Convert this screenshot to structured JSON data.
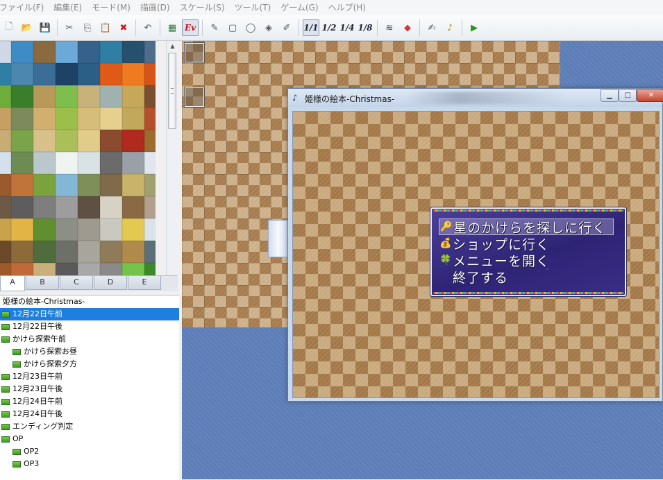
{
  "menubar": {
    "items": [
      {
        "key": "file",
        "label": "ファイル(F)"
      },
      {
        "key": "edit",
        "label": "編集(E)"
      },
      {
        "key": "mode",
        "label": "モード(M)"
      },
      {
        "key": "draw",
        "label": "描画(D)"
      },
      {
        "key": "scale",
        "label": "スケール(S)"
      },
      {
        "key": "tools",
        "label": "ツール(T)"
      },
      {
        "key": "game",
        "label": "ゲーム(G)"
      },
      {
        "key": "help",
        "label": "ヘルプ(H)"
      }
    ]
  },
  "toolbar": {
    "icons": [
      "new-project-icon",
      "open-project-icon",
      "save-project-icon",
      "cut-icon",
      "copy-icon",
      "paste-icon",
      "delete-icon",
      "undo-icon",
      "map-layer-icon",
      "event-layer-icon",
      "pencil-icon",
      "rectangle-icon",
      "ellipse-icon",
      "fill-icon",
      "shadow-pen-icon",
      "database-icon",
      "material-manager-icon",
      "script-editor-icon",
      "sound-test-icon",
      "playtest-icon"
    ],
    "ev_label": "Ev",
    "scales": [
      "1/1",
      "1/2",
      "1/4",
      "1/8"
    ]
  },
  "tileset": {
    "tabs": [
      "A",
      "B",
      "C",
      "D",
      "E"
    ],
    "active_tab": "A",
    "colors": [
      "#cfd8e6",
      "#3f8cc4",
      "#8a6a3e",
      "#6aa9d8",
      "#36618a",
      "#2f7fa5",
      "#274f6e",
      "#4d6d8a",
      "#2f7fa5",
      "#4c87b0",
      "#3b6d98",
      "#1e4266",
      "#2c5f85",
      "#e05a17",
      "#f07a1f",
      "#d4541a",
      "#6fae3c",
      "#3a7d2a",
      "#b79a5a",
      "#7fbe4c",
      "#c8b27a",
      "#9fb2b0",
      "#c6a85a",
      "#7b5030",
      "#c6a062",
      "#7d8a5b",
      "#d1b06f",
      "#9cbf4c",
      "#d7bd7a",
      "#e5d08f",
      "#c2a85a",
      "#b54f2c",
      "#c7ad73",
      "#7aa34a",
      "#d8c08a",
      "#a9c05a",
      "#e2cc8a",
      "#8a4b2e",
      "#b02a1e",
      "#9c6b2d",
      "#d4e0ec",
      "#6d8b52",
      "#bcc7cc",
      "#f0f4f0",
      "#d9e3e6",
      "#6b6b6b",
      "#9aa0a8",
      "#dfe6ee",
      "#9b5a2e",
      "#c1743a",
      "#7aa33f",
      "#84b6d6",
      "#7f8f5a",
      "#7f6a4a",
      "#c9b36a",
      "#a0a070",
      "#6e5a44",
      "#5d5d5d",
      "#7e7e7e",
      "#9d9d9d",
      "#5e5042",
      "#d8d2c4",
      "#8a6a45",
      "#b3a08c",
      "#c9a24a",
      "#e1b445",
      "#5f8f2f",
      "#8b8f86",
      "#9e9a90",
      "#c9c9c0",
      "#e3c94f",
      "#dbe3ea",
      "#6b4a2a",
      "#8c6a3a",
      "#4f6d3c",
      "#6f6f6a",
      "#a8a59c",
      "#8f7a5a",
      "#b08a4a",
      "#5a6f7a",
      "#a05a2a",
      "#c06a3a",
      "#c9b07a",
      "#5a5a5a",
      "#a8a8a8",
      "#8a8a8a",
      "#72c44a",
      "#3a8a2a"
    ]
  },
  "tree": {
    "root": "姫様の絵本-Christmas-",
    "items": [
      {
        "label": "12月22日午前",
        "level": 1,
        "selected": true
      },
      {
        "label": "12月22日午後",
        "level": 1,
        "selected": false
      },
      {
        "label": "かけら探索午前",
        "level": 1,
        "selected": false
      },
      {
        "label": "かけら探索お昼",
        "level": 2,
        "selected": false
      },
      {
        "label": "かけら探索夕方",
        "level": 2,
        "selected": false
      },
      {
        "label": "12月23日午前",
        "level": 1,
        "selected": false
      },
      {
        "label": "12月23日午後",
        "level": 1,
        "selected": false
      },
      {
        "label": "12月24日午前",
        "level": 1,
        "selected": false
      },
      {
        "label": "12月24日午後",
        "level": 1,
        "selected": false
      },
      {
        "label": "エンディング判定",
        "level": 1,
        "selected": false
      },
      {
        "label": "OP",
        "level": 1,
        "selected": false
      },
      {
        "label": "OP2",
        "level": 2,
        "selected": false
      },
      {
        "label": "OP3",
        "level": 2,
        "selected": false
      }
    ]
  },
  "game_window": {
    "title": "姫様の絵本-Christmas-",
    "controls": {
      "minimize": "▁",
      "maximize": "□",
      "close": "✕"
    },
    "commands": [
      {
        "icon": "key-icon",
        "glyph": "🔑",
        "label": "星のかけらを探しに行く",
        "selected": true
      },
      {
        "icon": "money-bag-icon",
        "glyph": "💰",
        "label": "ショップに行く",
        "selected": false
      },
      {
        "icon": "clover-icon",
        "glyph": "🍀",
        "label": "メニューを開く",
        "selected": false
      },
      {
        "icon": "",
        "glyph": "",
        "label": "終了する",
        "selected": false
      }
    ]
  }
}
